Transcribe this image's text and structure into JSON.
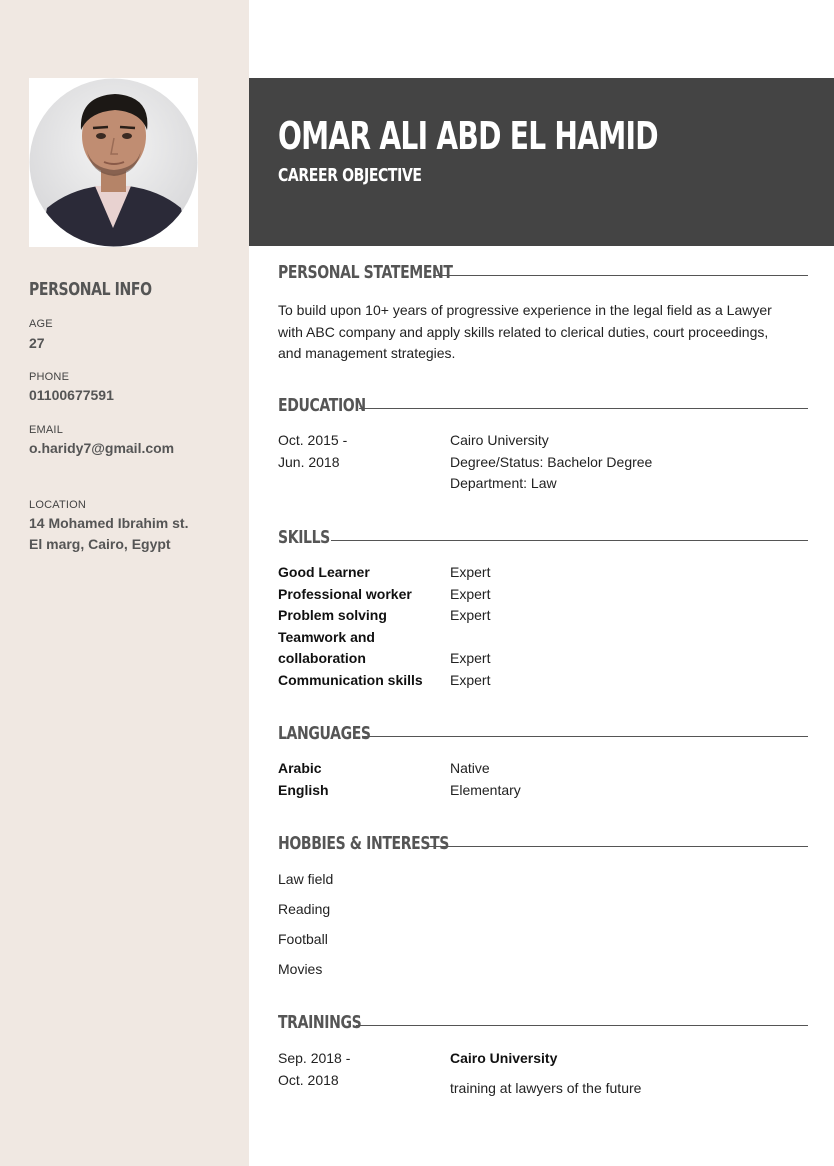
{
  "profile": {
    "name": "OMAR ALI ABD EL HAMID",
    "subtitle": "CAREER OBJECTIVE"
  },
  "personal_info": {
    "heading": "PERSONAL INFO",
    "age_label": "AGE",
    "age": "27",
    "phone_label": "PHONE",
    "phone": "01100677591",
    "email_label": "EMAIL",
    "email": "o.haridy7@gmail.com",
    "location_label": "LOCATION",
    "location_line1": "14 Mohamed Ibrahim st.",
    "location_line2": "El marg, Cairo, Egypt"
  },
  "statement": {
    "title": "PERSONAL STATEMENT",
    "lines": [
      "To build upon 10+ years of progressive experience in the legal field as a Lawyer",
      "with ABC company and apply skills related to clerical duties, court proceedings,",
      "and management strategies."
    ]
  },
  "education": {
    "title": "EDUCATION",
    "dates": [
      "Oct. 2015 -",
      "Jun. 2018"
    ],
    "details": [
      "Cairo University",
      "Degree/Status: Bachelor Degree",
      "Department: Law"
    ]
  },
  "skills": {
    "title": "SKILLS",
    "items": [
      {
        "name": "Good Learner",
        "level": "Expert"
      },
      {
        "name": "Professional worker",
        "level": "Expert"
      },
      {
        "name": "Problem solving",
        "level": "Expert"
      },
      {
        "name": "Teamwork and",
        "level": ""
      },
      {
        "name": "collaboration",
        "level": "Expert"
      },
      {
        "name": "Communication skills",
        "level": "Expert"
      }
    ]
  },
  "languages": {
    "title": "LANGUAGES",
    "items": [
      {
        "name": "Arabic",
        "level": "Native"
      },
      {
        "name": "English",
        "level": "Elementary"
      }
    ]
  },
  "hobbies": {
    "title": "HOBBIES & INTERESTS",
    "items": [
      "Law field",
      "Reading",
      "Football",
      "Movies"
    ]
  },
  "trainings": {
    "title": "TRAININGS",
    "dates": [
      "Sep. 2018 -",
      "Oct. 2018"
    ],
    "institution": "Cairo University",
    "description": "training at lawyers of the future"
  }
}
